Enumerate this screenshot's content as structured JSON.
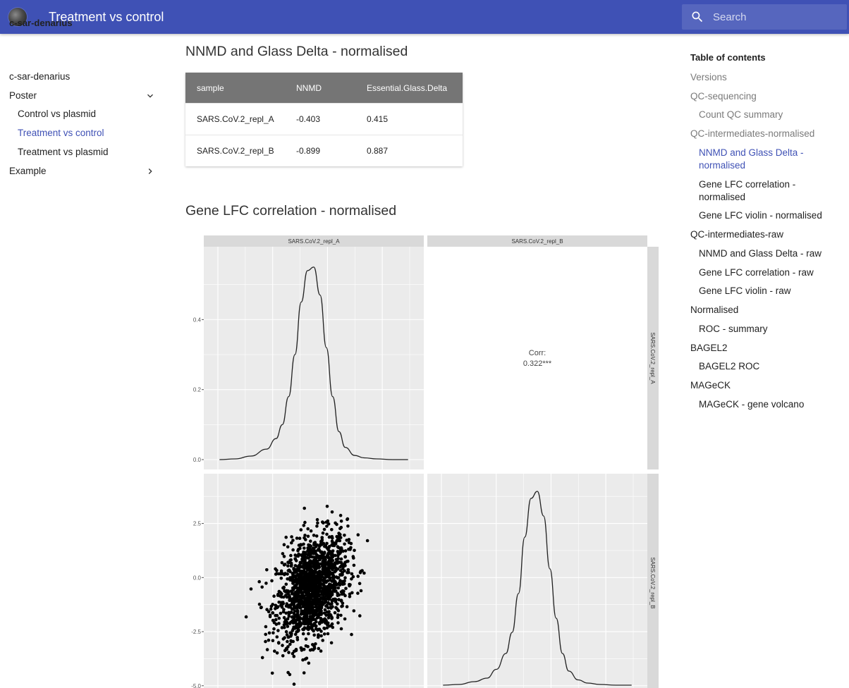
{
  "header": {
    "title": "Treatment vs control",
    "search_placeholder": "Search",
    "logo_icon": "site-logo-icon",
    "search_icon": "search-icon",
    "bar_color": "#3f51b5"
  },
  "nav": {
    "root": "c-sar-denarius",
    "items": [
      {
        "label": "c-sar-denarius"
      },
      {
        "label": "Poster",
        "icon": "chevron-down-icon"
      },
      {
        "label": "Control vs plasmid"
      },
      {
        "label": "Treatment vs control",
        "active": true
      },
      {
        "label": "Treatment vs plasmid"
      },
      {
        "label": "Example",
        "icon": "chevron-right-icon"
      }
    ]
  },
  "main": {
    "section1_title": "NNMD and Glass Delta - normalised",
    "table": {
      "headers": [
        "sample",
        "NNMD",
        "Essential.Glass.Delta"
      ],
      "rows": [
        [
          "SARS.CoV.2_repl_A",
          "-0.403",
          "0.415"
        ],
        [
          "SARS.CoV.2_repl_B",
          "-0.899",
          "0.887"
        ]
      ]
    },
    "section2_title": "Gene LFC correlation - normalised"
  },
  "chart_data": {
    "type": "scatter",
    "panels": {
      "columns": [
        "SARS.CoV.2_repl_A",
        "SARS.CoV.2_repl_B"
      ],
      "rows": [
        "SARS.CoV.2_repl_A",
        "SARS.CoV.2_repl_B"
      ]
    },
    "density_A": {
      "yticks": [
        "0.0",
        "0.2",
        "0.4"
      ],
      "ylim": [
        0,
        0.58
      ],
      "peak_y": 0.55,
      "x": [
        -3.0,
        -2.5,
        -2.0,
        -1.5,
        -1.2,
        -1.0,
        -0.8,
        -0.6,
        -0.4,
        -0.2,
        0.0,
        0.2,
        0.4,
        0.6,
        0.8,
        1.0,
        1.3,
        1.6,
        2.0,
        2.5,
        3.0
      ],
      "y": [
        0.0,
        0.002,
        0.01,
        0.03,
        0.06,
        0.1,
        0.18,
        0.3,
        0.45,
        0.54,
        0.55,
        0.47,
        0.32,
        0.18,
        0.08,
        0.035,
        0.012,
        0.005,
        0.002,
        0.0,
        0.0
      ]
    },
    "correlation": {
      "label": "Corr:",
      "value": "0.322***"
    },
    "scatter": {
      "yticks": [
        "2.5",
        "0.0",
        "-2.5",
        "-5.0"
      ],
      "ylim": [
        -5.3,
        4.8
      ],
      "n_points": 1600,
      "x_center": 0.05,
      "y_center": -0.5,
      "sx": 0.55,
      "sy": 1.25,
      "rho": 0.32
    },
    "density_B": {
      "x": [
        -3.0,
        -2.5,
        -2.0,
        -1.6,
        -1.3,
        -1.0,
        -0.8,
        -0.6,
        -0.4,
        -0.2,
        0.0,
        0.2,
        0.4,
        0.6,
        0.8,
        1.0,
        1.3,
        1.6,
        2.0,
        2.5,
        3.0
      ],
      "y": [
        0.0,
        0.002,
        0.01,
        0.02,
        0.045,
        0.09,
        0.15,
        0.26,
        0.42,
        0.53,
        0.55,
        0.48,
        0.33,
        0.19,
        0.09,
        0.04,
        0.015,
        0.006,
        0.002,
        0.0,
        0.0
      ]
    }
  },
  "toc": {
    "title": "Table of contents",
    "items": [
      {
        "label": "Versions",
        "level": 1,
        "state": "grey"
      },
      {
        "label": "QC-sequencing",
        "level": 1,
        "state": "grey"
      },
      {
        "label": "Count QC summary",
        "level": 2,
        "state": "grey"
      },
      {
        "label": "QC-intermediates-normalised",
        "level": 1,
        "state": "grey"
      },
      {
        "label": "NNMD and Glass Delta - normalised",
        "level": 2,
        "state": "active"
      },
      {
        "label": "Gene LFC correlation - normalised",
        "level": 2,
        "state": "normal"
      },
      {
        "label": "Gene LFC violin - normalised",
        "level": 2,
        "state": "normal"
      },
      {
        "label": "QC-intermediates-raw",
        "level": 1,
        "state": "normal"
      },
      {
        "label": "NNMD and Glass Delta - raw",
        "level": 2,
        "state": "normal"
      },
      {
        "label": "Gene LFC correlation - raw",
        "level": 2,
        "state": "normal"
      },
      {
        "label": "Gene LFC violin - raw",
        "level": 2,
        "state": "normal"
      },
      {
        "label": "Normalised",
        "level": 1,
        "state": "normal"
      },
      {
        "label": "ROC - summary",
        "level": 2,
        "state": "normal"
      },
      {
        "label": "BAGEL2",
        "level": 1,
        "state": "normal"
      },
      {
        "label": "BAGEL2 ROC",
        "level": 2,
        "state": "normal"
      },
      {
        "label": "MAGeCK",
        "level": 1,
        "state": "normal"
      },
      {
        "label": "MAGeCK - gene volcano",
        "level": 2,
        "state": "normal"
      }
    ]
  }
}
